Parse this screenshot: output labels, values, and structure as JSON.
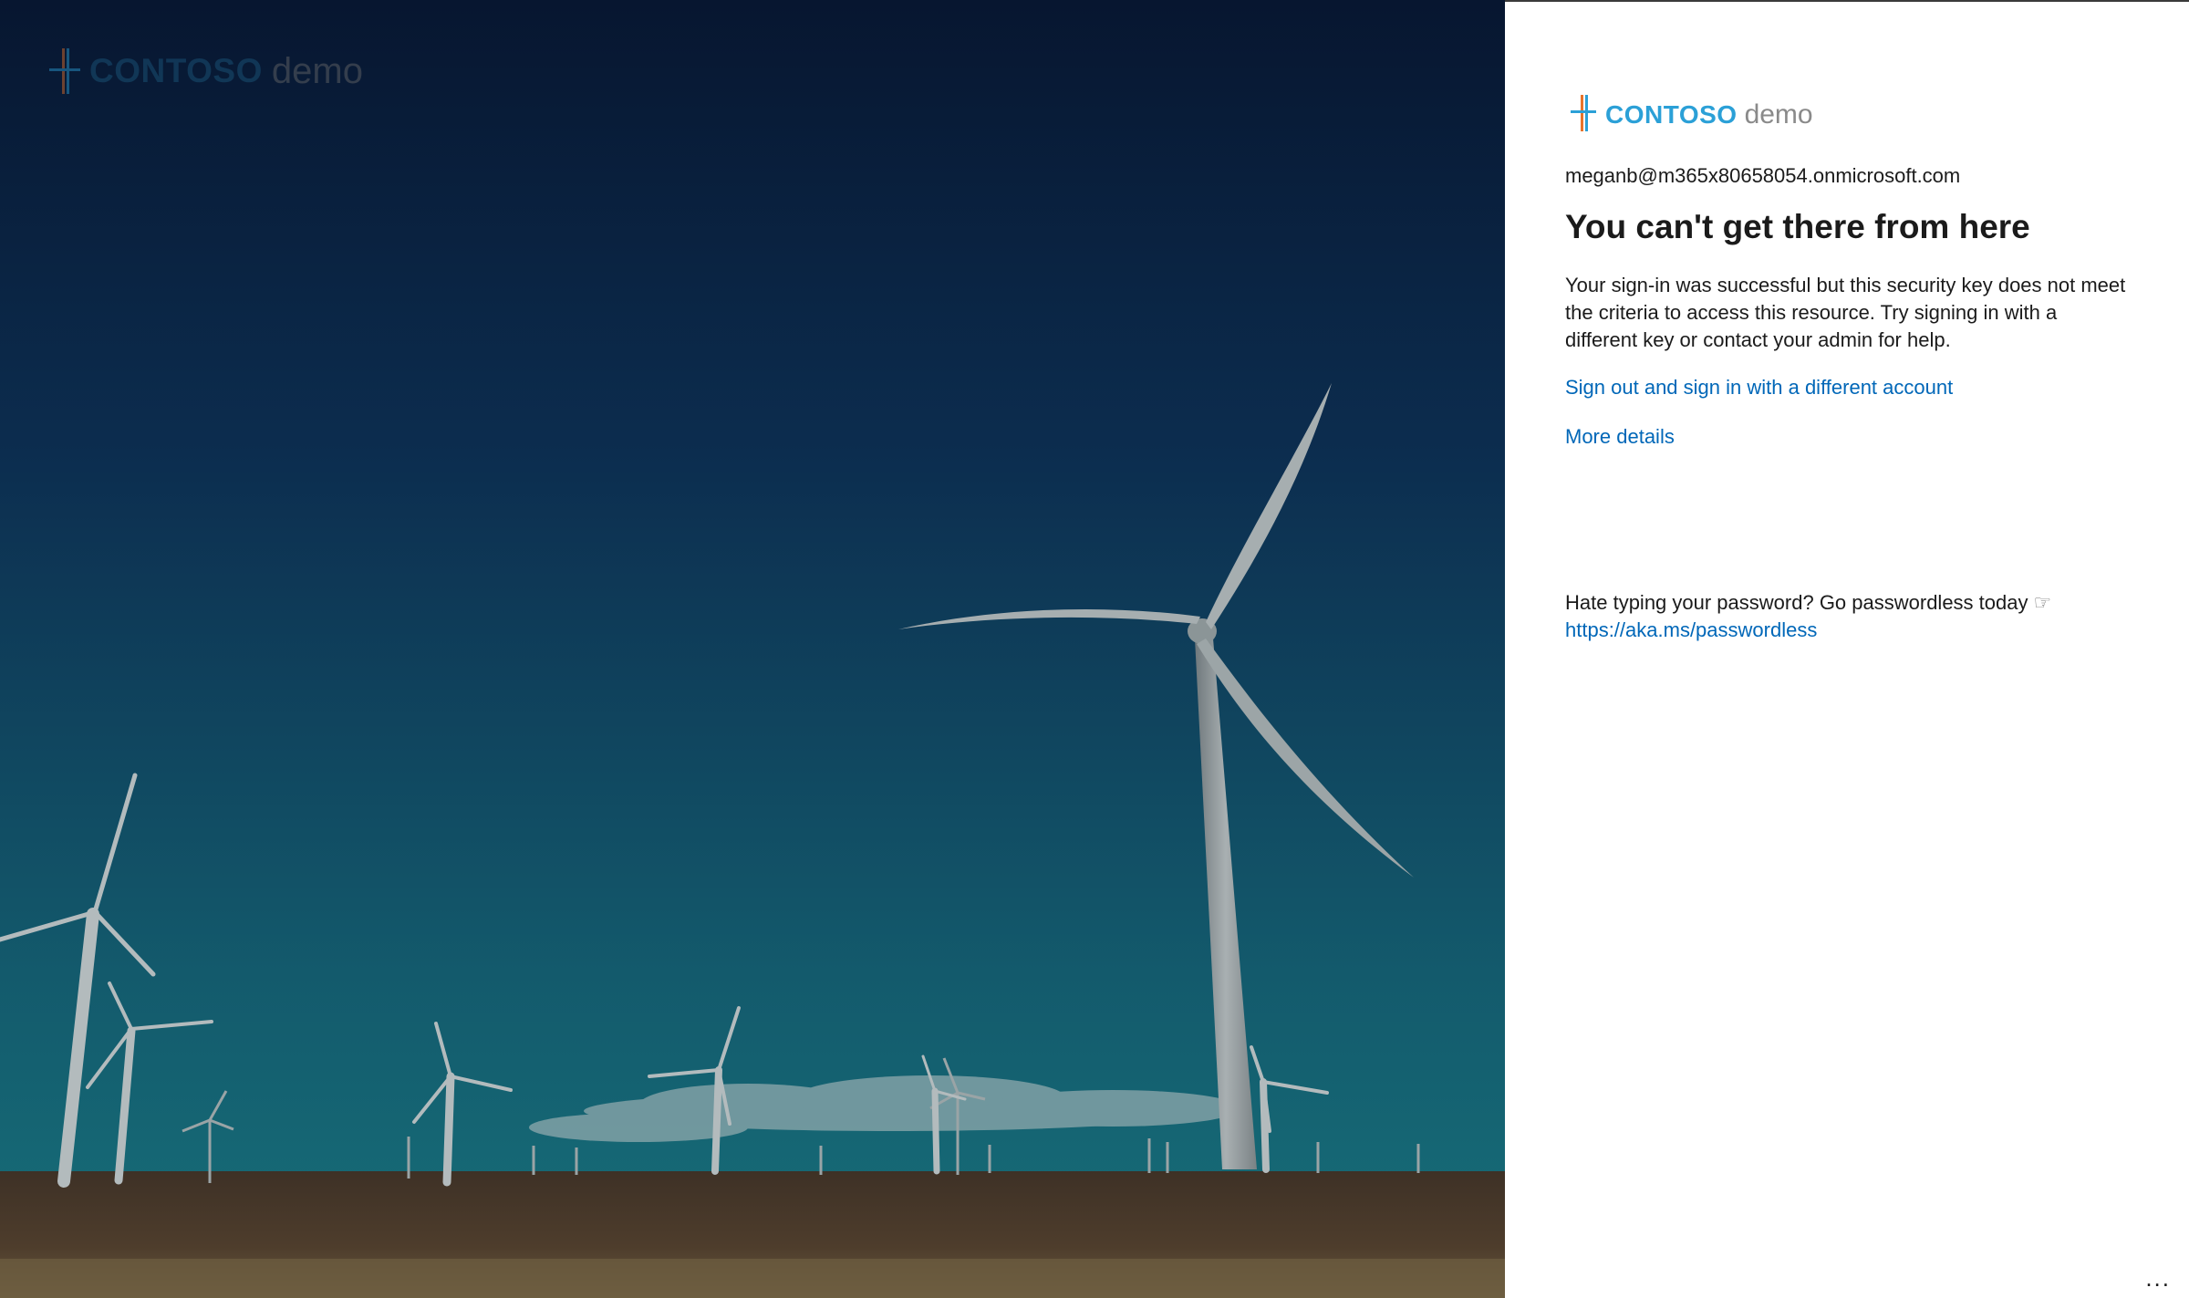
{
  "brand": {
    "name": "CONTOSO",
    "suffix": "demo"
  },
  "account": "meganb@m365x80658054.onmicrosoft.com",
  "title": "You can't get there from here",
  "message": "Your sign-in was successful but this security key does not meet the criteria to access this resource. Try signing in with a different key or contact your admin for help.",
  "links": {
    "signout": "Sign out and sign in with a different account",
    "details": "More details"
  },
  "promo": {
    "text": "Hate typing your password? Go passwordless today",
    "icon": "pointing-hand-icon",
    "link": "https://aka.ms/passwordless"
  },
  "footer": {
    "more_options": "..."
  },
  "colors": {
    "accent": "#2ba0d7",
    "link": "#0067b8",
    "logo_orange": "#e8732a",
    "sky_top": "#0a1c3a",
    "sky_bottom": "#14606f",
    "ground": "#4a3a2a"
  }
}
